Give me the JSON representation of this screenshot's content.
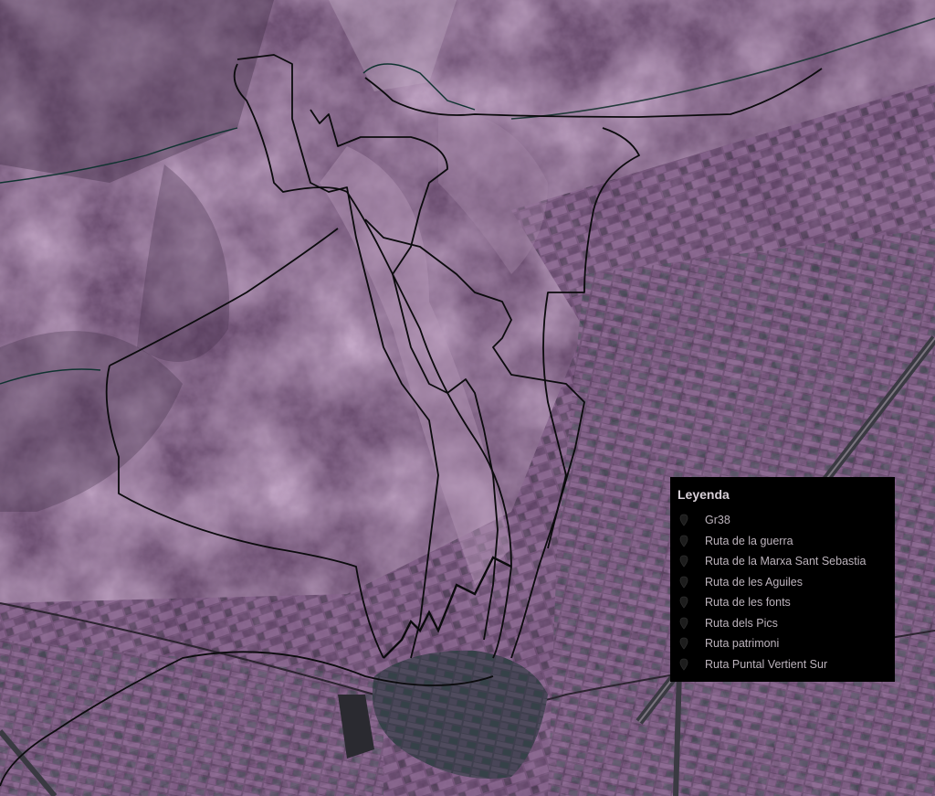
{
  "map": {
    "style": "satellite-purple",
    "colors": {
      "route_line": "#0b0b0d",
      "route_line_alt": "#0f3330",
      "legend_bg": "#000000",
      "legend_text": "#bcb3bc",
      "legend_title": "#d8d0d8"
    }
  },
  "legend": {
    "title": "Leyenda",
    "items": [
      {
        "label": "Gr38",
        "icon": "route-marker-icon"
      },
      {
        "label": "Ruta de la guerra",
        "icon": "route-marker-icon"
      },
      {
        "label": "Ruta de la Marxa Sant Sebastia",
        "icon": "route-marker-icon"
      },
      {
        "label": "Ruta de les Aguiles",
        "icon": "route-marker-icon"
      },
      {
        "label": "Ruta de les fonts",
        "icon": "route-marker-icon"
      },
      {
        "label": "Ruta dels Pics",
        "icon": "route-marker-icon"
      },
      {
        "label": "Ruta patrimoni",
        "icon": "route-marker-icon"
      },
      {
        "label": "Ruta Puntal Vertient Sur",
        "icon": "route-marker-icon"
      }
    ]
  }
}
